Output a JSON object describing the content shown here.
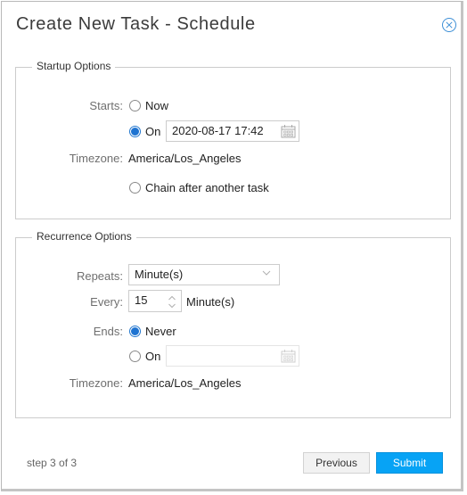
{
  "dialog": {
    "title": "Create New Task - Schedule",
    "close_icon": "close-circle-icon"
  },
  "startup": {
    "legend": "Startup Options",
    "starts_label": "Starts:",
    "options": [
      {
        "label": "Now",
        "selected": false
      },
      {
        "label": "On",
        "selected": true
      },
      {
        "label": "Chain after another task",
        "selected": false
      }
    ],
    "datetime_value": "2020-08-17 17:42",
    "calendar_icon": "calendar-icon",
    "timezone_label": "Timezone:",
    "timezone_value": "America/Los_Angeles"
  },
  "recurrence": {
    "legend": "Recurrence Options",
    "repeats_label": "Repeats:",
    "repeats_value": "Minute(s)",
    "every_label": "Every:",
    "every_value": "15",
    "every_unit": "Minute(s)",
    "ends_label": "Ends:",
    "ends_options": [
      {
        "label": "Never",
        "selected": true
      },
      {
        "label": "On",
        "selected": false
      }
    ],
    "ends_date_value": "",
    "timezone_label": "Timezone:",
    "timezone_value": "America/Los_Angeles"
  },
  "footer": {
    "step_text": "step 3 of 3",
    "previous_label": "Previous",
    "submit_label": "Submit",
    "submit_color": "#07a3f5"
  }
}
